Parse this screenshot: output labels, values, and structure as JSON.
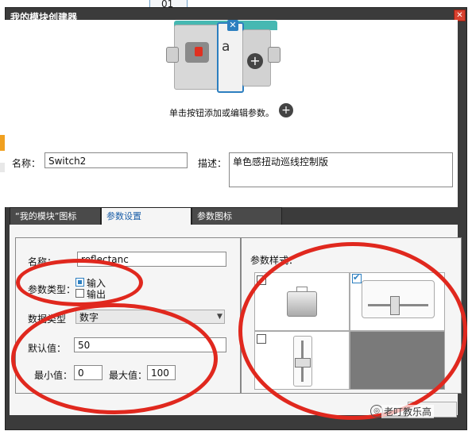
{
  "background": {
    "partial_text": "01"
  },
  "dialog": {
    "title": "我的模块创建器",
    "close_glyph": "✕"
  },
  "preview": {
    "param_label": "a",
    "param_remove_glyph": "✕",
    "add_glyph": "+",
    "hint": "单击按钮添加或编辑参数。",
    "hint_add_glyph": "+"
  },
  "module": {
    "name_label": "名称：",
    "name_value": "Switch2",
    "desc_label": "描述：",
    "desc_value": "单色感扭动巡线控制版"
  },
  "tabs": [
    {
      "label": "“我的模块”图标",
      "active": false
    },
    {
      "label": "参数设置",
      "active": true
    },
    {
      "label": "参数图标",
      "active": false
    }
  ],
  "param": {
    "name_label": "名称：",
    "name_value": "reflectanc",
    "type_label": "参数类型：",
    "type_input": "输入",
    "type_output": "输出",
    "dtype_label": "数据类型",
    "dtype_value": "数字",
    "default_label": "默认值：",
    "default_value": "50",
    "min_label": "最小值：",
    "min_value": "0",
    "max_label": "最大值：",
    "max_value": "100"
  },
  "styles": {
    "label": "参数样式：",
    "options": [
      {
        "icon": "box-input-icon",
        "checked": false
      },
      {
        "icon": "horizontal-slider-icon",
        "checked": true
      },
      {
        "icon": "vertical-slider-icon",
        "checked": false
      }
    ],
    "check_glyph": "✔"
  },
  "watermark": {
    "text": "老叮教乐高",
    "icon_glyph": "◎"
  },
  "colors": {
    "accent": "#2d7fc0",
    "annotation": "#e0281e",
    "dialog_bg": "#3b3b3b",
    "block_top": "#46b8b2"
  }
}
